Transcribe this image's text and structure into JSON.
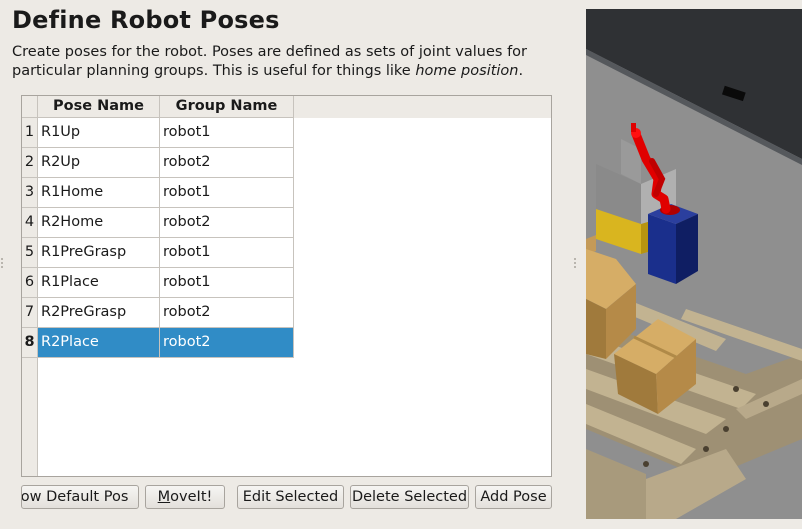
{
  "page": {
    "title": "Define Robot Poses",
    "description_plain": "Create poses for the robot. Poses are defined as sets of joint values for particular planning groups. This is useful for things like ",
    "description_italic": "home position",
    "description_end": "."
  },
  "table": {
    "headers": [
      "Pose Name",
      "Group Name"
    ],
    "rows": [
      {
        "num": "1",
        "pose": "R1Up",
        "group": "robot1"
      },
      {
        "num": "2",
        "pose": "R2Up",
        "group": "robot2"
      },
      {
        "num": "3",
        "pose": "R1Home",
        "group": "robot1"
      },
      {
        "num": "4",
        "pose": "R2Home",
        "group": "robot2"
      },
      {
        "num": "5",
        "pose": "R1PreGrasp",
        "group": "robot1"
      },
      {
        "num": "6",
        "pose": "R1Place",
        "group": "robot1"
      },
      {
        "num": "7",
        "pose": "R2PreGrasp",
        "group": "robot2"
      },
      {
        "num": "8",
        "pose": "R2Place",
        "group": "robot2"
      }
    ],
    "selected_row": "8"
  },
  "buttons": {
    "show_default": "how Default Pos",
    "moveit_mnemonic": "M",
    "moveit_rest": "oveIt!",
    "edit_selected": "Edit Selected",
    "delete_selected": "Delete Selected",
    "add_pose": "Add Pose"
  },
  "colors": {
    "selection": "#308cc6",
    "robot_arm": "#e00000",
    "robot_base": "#1a2f8c",
    "floor": "#8f8f8f",
    "wall": "#2f3134",
    "cardboard_box": "#c49a58",
    "pallet_wood": "#b8a98a"
  },
  "viewport": {
    "scene_objects": [
      "wall",
      "floor",
      "robot-arm",
      "robot-base-pedestal",
      "bin",
      "cardboard-box",
      "wooden-pallet"
    ]
  }
}
